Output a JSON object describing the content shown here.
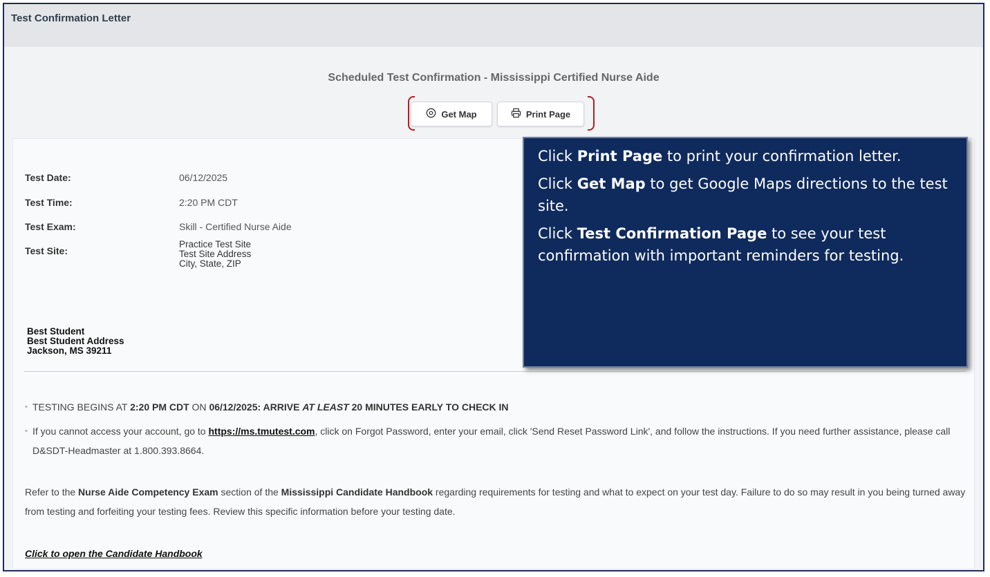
{
  "window": {
    "title": "Test Confirmation Letter"
  },
  "header": {
    "scheduled_title": "Scheduled Test Confirmation - Mississippi Certified Nurse Aide",
    "get_map_label": "Get Map",
    "print_page_label": "Print Page"
  },
  "details": {
    "test_date_label": "Test Date:",
    "test_date": "06/12/2025",
    "test_time_label": "Test Time:",
    "test_time": "2:20 PM CDT",
    "test_exam_label": "Test Exam:",
    "test_exam": "Skill - Certified Nurse Aide",
    "test_site_label": "Test Site:",
    "site_line1": "Practice Test Site",
    "site_line2": "Test Site Address",
    "site_line3": "City, State, ZIP"
  },
  "candidate": {
    "name": "Best Student",
    "address": "Best Student Address",
    "city_state_zip": "Jackson, MS 39211"
  },
  "notices": {
    "b1_pre": "TESTING BEGINS AT ",
    "b1_time": "2:20 PM CDT",
    "b1_on": " ON ",
    "b1_date": "06/12/2025:  ARRIVE ",
    "b1_atleast": "AT LEAST",
    "b1_post": " 20 MINUTES EARLY TO CHECK IN",
    "b2_pre": "If you cannot access your account, go to ",
    "b2_link": "https://ms.tmutest.com",
    "b2_post": ", click on Forgot Password, enter your email, click 'Send Reset Password Link', and follow the instructions.  If you need further assistance, please call D&SDT-Headmaster at 1.800.393.8664.",
    "ref_pre": "Refer to the ",
    "ref_section": "Nurse Aide Competency Exam",
    "ref_mid": " section of the ",
    "ref_handbook": "Mississippi Candidate Handbook",
    "ref_post": " regarding requirements for testing and what to expect on your test day.  Failure to do so may result in you being turned away from testing and forfeiting your testing fees.  Review this specific information before your testing date.",
    "handbook_link": "Click to open the Candidate Handbook"
  },
  "callout": {
    "p1_pre": "Click ",
    "p1_bold": "Print Page",
    "p1_post": " to print your confirmation letter.",
    "p2_pre": "Click ",
    "p2_bold": "Get Map",
    "p2_post": " to get Google Maps directions to the test site.",
    "p3_pre": "Click ",
    "p3_bold": "Test Confirmation Page",
    "p3_post": " to see your test confirmation with important reminders for testing."
  },
  "colors": {
    "callout_bg": "#0f2a5c",
    "bracket": "#b21e23",
    "frame_border": "#1c2c5a"
  },
  "icons": {
    "map": "location-pin-icon",
    "print": "printer-icon"
  }
}
